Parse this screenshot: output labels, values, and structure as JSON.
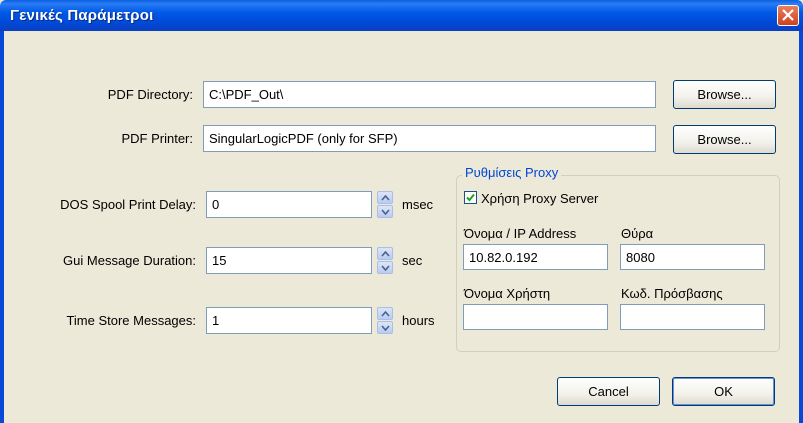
{
  "window": {
    "title": "Γενικές Παράμετροι"
  },
  "pdf_directory": {
    "label": "PDF Directory:",
    "value": "C:\\PDF_Out\\",
    "browse_label": "Browse..."
  },
  "pdf_printer": {
    "label": "PDF Printer:",
    "value": "SingularLogicPDF (only for SFP)",
    "browse_label": "Browse..."
  },
  "dos_spool": {
    "label": "DOS Spool Print Delay:",
    "value": "0",
    "unit": "msec"
  },
  "gui_message": {
    "label": "Gui Message Duration:",
    "value": "15",
    "unit": "sec"
  },
  "time_store": {
    "label": "Time Store Messages:",
    "value": "1",
    "unit": "hours"
  },
  "proxy": {
    "group_label": "Ρυθμίσεις Proxy",
    "use_proxy_label": "Χρήση Proxy Server",
    "use_proxy_checked": true,
    "host_label": "Όνομα / IP Address",
    "host_value": "10.82.0.192",
    "port_label": "Θύρα",
    "port_value": "8080",
    "user_label": "Όνομα Χρήστη",
    "user_value": "",
    "password_label": "Κωδ. Πρόσβασης",
    "password_value": ""
  },
  "buttons": {
    "cancel": "Cancel",
    "ok": "OK"
  }
}
